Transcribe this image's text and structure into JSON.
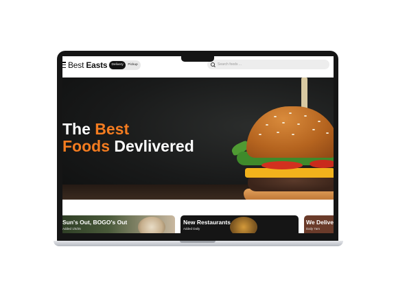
{
  "navbar": {
    "brand_regular": "Best ",
    "brand_bold": "Easts",
    "delivery_label": "Delivery",
    "pickup_label": "Pickup",
    "search_placeholder": "Search foods ..."
  },
  "hero": {
    "line1_white": "The ",
    "line1_orange": "Best",
    "line2_orange": "Foods",
    "line2_white": " Devlivered"
  },
  "cards": [
    {
      "title": "Sun's Out, BOGO's Out",
      "subtitle": "Added 1/5/25"
    },
    {
      "title": "New Restaurants",
      "subtitle": "Added Daily"
    },
    {
      "title": "We Deliver",
      "subtitle": "Daily 7am"
    }
  ],
  "colors": {
    "accent": "#f47c20",
    "hero_bg": "#191a1a",
    "laptop_frame": "#151515"
  },
  "icons": [
    "menu-icon",
    "search-icon"
  ]
}
